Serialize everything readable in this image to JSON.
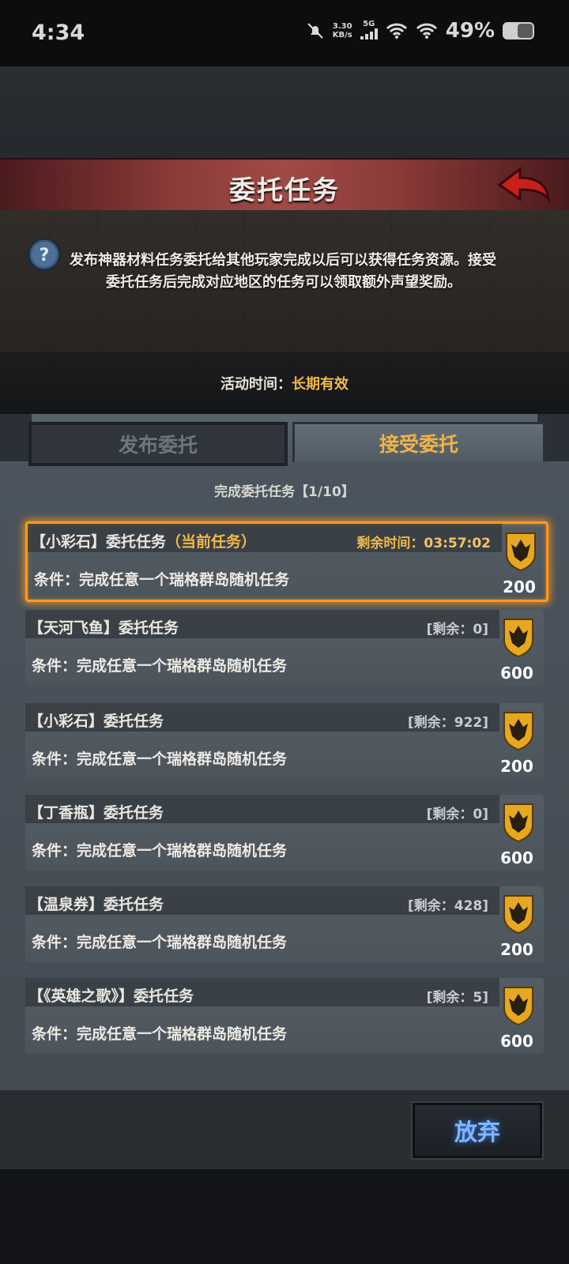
{
  "status_bar": {
    "time": "4:34",
    "net_speed": "3.30",
    "net_unit": "KB/s",
    "signal_label": "5G",
    "battery": "49%"
  },
  "header": {
    "title": "委托任务"
  },
  "info": {
    "text_line1": "发布神器材料任务委托给其他玩家完成以后可以获得任务资源。接受",
    "text_line2": "委托任务后完成对应地区的任务可以领取额外声望奖励。"
  },
  "activity": {
    "label": "活动时间：",
    "value": "长期有效"
  },
  "tabs": [
    {
      "label": "发布委托",
      "active": false
    },
    {
      "label": "接受委托",
      "active": true
    }
  ],
  "progress_text": "完成委托任务【1/10】",
  "tasks": [
    {
      "name": "【小彩石】委托任务",
      "current_tag": "（当前任务）",
      "remain_label": "剩余时间：",
      "remain_value": "03:57:02",
      "condition": "条件：完成任意一个瑞格群岛随机任务",
      "reward": "200"
    },
    {
      "name": "【天河飞鱼】委托任务",
      "current_tag": "",
      "remain_label": "",
      "remain_value": "[剩余：0]",
      "condition": "条件：完成任意一个瑞格群岛随机任务",
      "reward": "600"
    },
    {
      "name": "【小彩石】委托任务",
      "current_tag": "",
      "remain_label": "",
      "remain_value": "[剩余：922]",
      "condition": "条件：完成任意一个瑞格群岛随机任务",
      "reward": "200"
    },
    {
      "name": "【丁香瓶】委托任务",
      "current_tag": "",
      "remain_label": "",
      "remain_value": "[剩余：0]",
      "condition": "条件：完成任意一个瑞格群岛随机任务",
      "reward": "600"
    },
    {
      "name": "【温泉券】委托任务",
      "current_tag": "",
      "remain_label": "",
      "remain_value": "[剩余：428]",
      "condition": "条件：完成任意一个瑞格群岛随机任务",
      "reward": "200"
    },
    {
      "name": "【《英雄之歌》】委托任务",
      "current_tag": "",
      "remain_label": "",
      "remain_value": "[剩余：5]",
      "condition": "条件：完成任意一个瑞格群岛随机任务",
      "reward": "600"
    }
  ],
  "footer": {
    "abandon_label": "放弃"
  },
  "colors": {
    "accent_gold": "#f1b84a",
    "title_red": "#8a3a38",
    "button_blue": "#7fb6ff",
    "highlight_orange": "#ff9a1a"
  }
}
